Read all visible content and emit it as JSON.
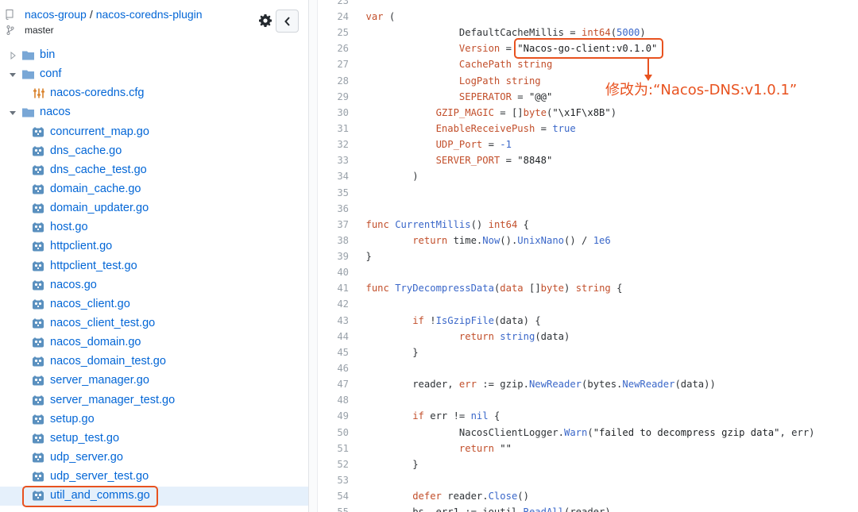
{
  "repo": {
    "owner": "nacos-group",
    "separator": "/",
    "name": "nacos-coredns-plugin",
    "branch": "master"
  },
  "sidebar": {
    "tree": [
      {
        "type": "folder",
        "name": "bin",
        "expanded": false,
        "depth": 0
      },
      {
        "type": "folder",
        "name": "conf",
        "expanded": true,
        "depth": 0
      },
      {
        "type": "config-file",
        "name": "nacos-coredns.cfg",
        "depth": 1
      },
      {
        "type": "folder",
        "name": "nacos",
        "expanded": true,
        "depth": 0
      },
      {
        "type": "file",
        "name": "concurrent_map.go",
        "depth": 1
      },
      {
        "type": "file",
        "name": "dns_cache.go",
        "depth": 1
      },
      {
        "type": "file",
        "name": "dns_cache_test.go",
        "depth": 1
      },
      {
        "type": "file",
        "name": "domain_cache.go",
        "depth": 1
      },
      {
        "type": "file",
        "name": "domain_updater.go",
        "depth": 1
      },
      {
        "type": "file",
        "name": "host.go",
        "depth": 1
      },
      {
        "type": "file",
        "name": "httpclient.go",
        "depth": 1
      },
      {
        "type": "file",
        "name": "httpclient_test.go",
        "depth": 1
      },
      {
        "type": "file",
        "name": "nacos.go",
        "depth": 1
      },
      {
        "type": "file",
        "name": "nacos_client.go",
        "depth": 1
      },
      {
        "type": "file",
        "name": "nacos_client_test.go",
        "depth": 1
      },
      {
        "type": "file",
        "name": "nacos_domain.go",
        "depth": 1
      },
      {
        "type": "file",
        "name": "nacos_domain_test.go",
        "depth": 1
      },
      {
        "type": "file",
        "name": "server_manager.go",
        "depth": 1
      },
      {
        "type": "file",
        "name": "server_manager_test.go",
        "depth": 1
      },
      {
        "type": "file",
        "name": "setup.go",
        "depth": 1
      },
      {
        "type": "file",
        "name": "setup_test.go",
        "depth": 1
      },
      {
        "type": "file",
        "name": "udp_server.go",
        "depth": 1
      },
      {
        "type": "file",
        "name": "udp_server_test.go",
        "depth": 1
      },
      {
        "type": "file",
        "name": "util_and_comms.go",
        "depth": 1,
        "selected": true,
        "highlighted": true
      }
    ]
  },
  "code": {
    "lines": [
      {
        "n": "23",
        "tokens": []
      },
      {
        "n": "24",
        "tokens": [
          [
            "k",
            "var"
          ],
          [
            "p",
            " ("
          ]
        ]
      },
      {
        "n": "25",
        "tokens": [
          [
            "p",
            "                DefaultCacheMillis = "
          ],
          [
            "t",
            "int64"
          ],
          [
            "p",
            "("
          ],
          [
            "n",
            "5000"
          ],
          [
            "p",
            ")"
          ]
        ]
      },
      {
        "n": "26",
        "tokens": [
          [
            "p",
            "                "
          ],
          [
            "c",
            "Version"
          ],
          [
            "p",
            " = "
          ],
          [
            "s",
            "\"Nacos-go-client:v0.1.0\""
          ]
        ]
      },
      {
        "n": "27",
        "tokens": [
          [
            "p",
            "                "
          ],
          [
            "c",
            "CachePath"
          ],
          [
            "p",
            " "
          ],
          [
            "t",
            "string"
          ]
        ]
      },
      {
        "n": "28",
        "tokens": [
          [
            "p",
            "                "
          ],
          [
            "c",
            "LogPath"
          ],
          [
            "p",
            " "
          ],
          [
            "t",
            "string"
          ]
        ]
      },
      {
        "n": "29",
        "tokens": [
          [
            "p",
            "                "
          ],
          [
            "c",
            "SEPERATOR"
          ],
          [
            "p",
            " = "
          ],
          [
            "s",
            "\"@@\""
          ]
        ]
      },
      {
        "n": "30",
        "tokens": [
          [
            "p",
            "            "
          ],
          [
            "c",
            "GZIP_MAGIC"
          ],
          [
            "p",
            " = []"
          ],
          [
            "t",
            "byte"
          ],
          [
            "p",
            "("
          ],
          [
            "s",
            "\"\\x1F\\x8B\""
          ],
          [
            "p",
            ")"
          ]
        ]
      },
      {
        "n": "31",
        "tokens": [
          [
            "p",
            "            "
          ],
          [
            "c",
            "EnableReceivePush"
          ],
          [
            "p",
            " = "
          ],
          [
            "n",
            "true"
          ]
        ]
      },
      {
        "n": "32",
        "tokens": [
          [
            "p",
            "            "
          ],
          [
            "c",
            "UDP_Port"
          ],
          [
            "p",
            " = "
          ],
          [
            "n",
            "-1"
          ]
        ]
      },
      {
        "n": "33",
        "tokens": [
          [
            "p",
            "            "
          ],
          [
            "c",
            "SERVER_PORT"
          ],
          [
            "p",
            " = "
          ],
          [
            "s",
            "\"8848\""
          ]
        ]
      },
      {
        "n": "34",
        "tokens": [
          [
            "p",
            "        )"
          ]
        ]
      },
      {
        "n": "35",
        "tokens": []
      },
      {
        "n": "36",
        "tokens": []
      },
      {
        "n": "37",
        "tokens": [
          [
            "k",
            "func"
          ],
          [
            "p",
            " "
          ],
          [
            "f",
            "CurrentMillis"
          ],
          [
            "p",
            "() "
          ],
          [
            "t",
            "int64"
          ],
          [
            "p",
            " {"
          ]
        ]
      },
      {
        "n": "38",
        "tokens": [
          [
            "p",
            "        "
          ],
          [
            "k",
            "return"
          ],
          [
            "p",
            " time."
          ],
          [
            "f",
            "Now"
          ],
          [
            "p",
            "()."
          ],
          [
            "f",
            "UnixNano"
          ],
          [
            "p",
            "() / "
          ],
          [
            "n",
            "1e6"
          ]
        ]
      },
      {
        "n": "39",
        "tokens": [
          [
            "p",
            "}"
          ]
        ]
      },
      {
        "n": "40",
        "tokens": []
      },
      {
        "n": "41",
        "tokens": [
          [
            "k",
            "func"
          ],
          [
            "p",
            " "
          ],
          [
            "f",
            "TryDecompressData"
          ],
          [
            "p",
            "("
          ],
          [
            "c",
            "data"
          ],
          [
            "p",
            " []"
          ],
          [
            "t",
            "byte"
          ],
          [
            "p",
            ") "
          ],
          [
            "t",
            "string"
          ],
          [
            "p",
            " {"
          ]
        ]
      },
      {
        "n": "42",
        "tokens": []
      },
      {
        "n": "43",
        "tokens": [
          [
            "p",
            "        "
          ],
          [
            "k",
            "if"
          ],
          [
            "p",
            " !"
          ],
          [
            "f",
            "IsGzipFile"
          ],
          [
            "p",
            "(data) {"
          ]
        ]
      },
      {
        "n": "44",
        "tokens": [
          [
            "p",
            "                "
          ],
          [
            "k",
            "return"
          ],
          [
            "p",
            " "
          ],
          [
            "f",
            "string"
          ],
          [
            "p",
            "(data)"
          ]
        ]
      },
      {
        "n": "45",
        "tokens": [
          [
            "p",
            "        }"
          ]
        ]
      },
      {
        "n": "46",
        "tokens": []
      },
      {
        "n": "47",
        "tokens": [
          [
            "p",
            "        reader, "
          ],
          [
            "c",
            "err"
          ],
          [
            "p",
            " := gzip."
          ],
          [
            "f",
            "NewReader"
          ],
          [
            "p",
            "(bytes."
          ],
          [
            "f",
            "NewReader"
          ],
          [
            "p",
            "(data))"
          ]
        ]
      },
      {
        "n": "48",
        "tokens": []
      },
      {
        "n": "49",
        "tokens": [
          [
            "p",
            "        "
          ],
          [
            "k",
            "if"
          ],
          [
            "p",
            " err != "
          ],
          [
            "n",
            "nil"
          ],
          [
            "p",
            " {"
          ]
        ]
      },
      {
        "n": "50",
        "tokens": [
          [
            "p",
            "                NacosClientLogger."
          ],
          [
            "f",
            "Warn"
          ],
          [
            "p",
            "("
          ],
          [
            "s",
            "\"failed to decompress gzip data\""
          ],
          [
            "p",
            ", err)"
          ]
        ]
      },
      {
        "n": "51",
        "tokens": [
          [
            "p",
            "                "
          ],
          [
            "k",
            "return"
          ],
          [
            "p",
            " "
          ],
          [
            "s",
            "\"\""
          ]
        ]
      },
      {
        "n": "52",
        "tokens": [
          [
            "p",
            "        }"
          ]
        ]
      },
      {
        "n": "53",
        "tokens": []
      },
      {
        "n": "54",
        "tokens": [
          [
            "p",
            "        "
          ],
          [
            "k",
            "defer"
          ],
          [
            "p",
            " reader."
          ],
          [
            "f",
            "Close"
          ],
          [
            "p",
            "()"
          ]
        ]
      },
      {
        "n": "55",
        "tokens": [
          [
            "p",
            "        bs, err1 := ioutil."
          ],
          [
            "f",
            "ReadAll"
          ],
          [
            "p",
            "(reader)"
          ]
        ]
      }
    ]
  },
  "annotation": {
    "text": "修改为:“Nacos-DNS:v1.0.1”"
  },
  "colors": {
    "accent": "#e8521f",
    "link": "#0366d6",
    "selected_row": "#e5f0fb"
  },
  "icons": {
    "repo": "repo-icon",
    "branch": "branch-icon",
    "gear": "gear-icon",
    "collapse": "chevron-left-icon",
    "folder": "folder-icon",
    "config": "config-file-icon",
    "go-file": "go-file-icon"
  }
}
